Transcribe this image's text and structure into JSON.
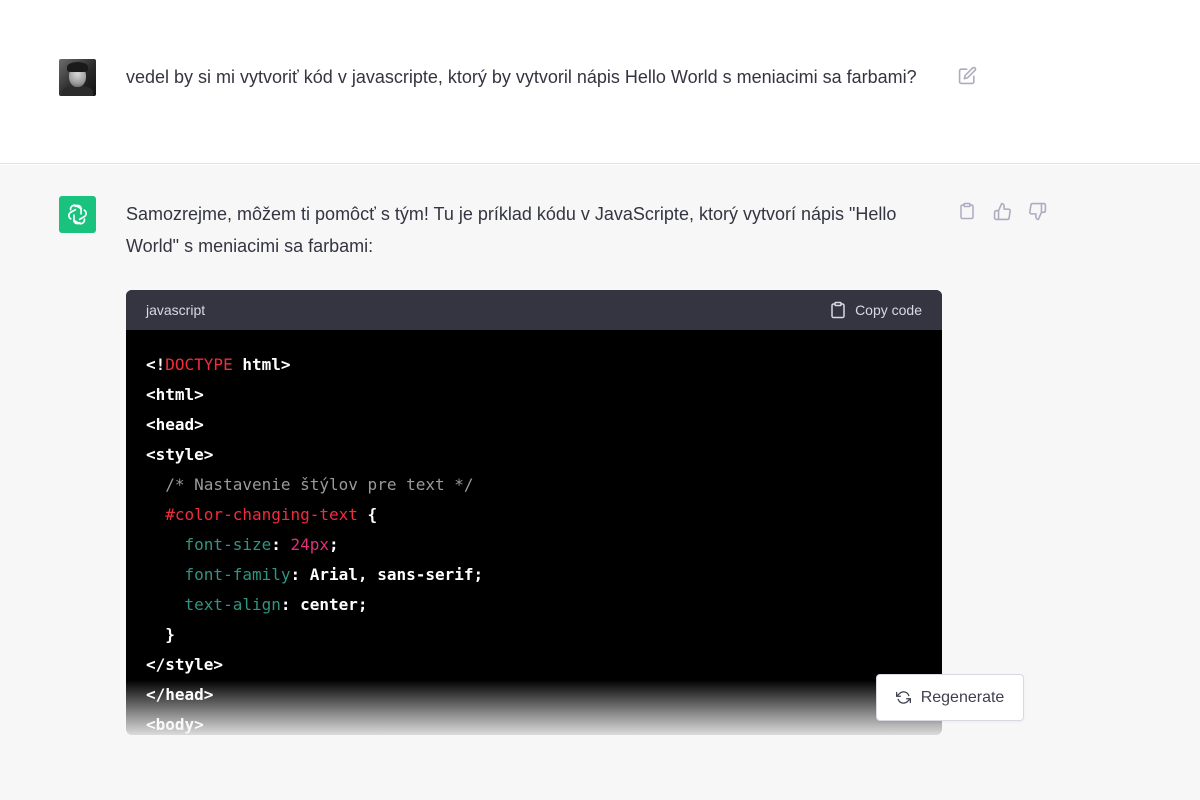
{
  "colors": {
    "accent": "#19c37d",
    "assistant_bg": "#f7f7f8",
    "code_bg": "#000000",
    "code_header_bg": "#343541"
  },
  "user_message": {
    "avatar": "user-photo",
    "text": "vedel by si mi vytvoriť kód v javascripte, ktorý by vytvoril nápis Hello World s meniacimi sa farbami?",
    "edit_icon": "edit-icon"
  },
  "assistant_message": {
    "avatar": "openai-logo-icon",
    "text": "Samozrejme, môžem ti pomôcť s tým! Tu je príklad kódu v JavaScripte, ktorý vytvorí nápis \"Hello World\" s meniacimi sa farbami:",
    "actions": [
      "clipboard-icon",
      "thumbs-up-icon",
      "thumbs-down-icon"
    ],
    "code_block": {
      "language": "javascript",
      "copy_label": "Copy code",
      "lines": [
        [
          {
            "t": "<!",
            "c": "tag"
          },
          {
            "t": "DOCTYPE",
            "c": "doctype"
          },
          {
            "t": " html>",
            "c": "tag"
          }
        ],
        [
          {
            "t": "<html>",
            "c": "tag"
          }
        ],
        [
          {
            "t": "<head>",
            "c": "tag"
          }
        ],
        [
          {
            "t": "<style>",
            "c": "tag"
          }
        ],
        [
          {
            "t": "  /* Nastavenie štýlov pre text */",
            "c": "comment"
          }
        ],
        [
          {
            "t": "  #color-changing-text",
            "c": "selector"
          },
          {
            "t": " {",
            "c": "tag"
          }
        ],
        [
          {
            "t": "    font-size",
            "c": "prop"
          },
          {
            "t": ": ",
            "c": "tag"
          },
          {
            "t": "24px",
            "c": "num"
          },
          {
            "t": ";",
            "c": "tag"
          }
        ],
        [
          {
            "t": "    font-family",
            "c": "prop"
          },
          {
            "t": ": Arial, sans-serif;",
            "c": "val"
          }
        ],
        [
          {
            "t": "    text-align",
            "c": "prop"
          },
          {
            "t": ": center;",
            "c": "val"
          }
        ],
        [
          {
            "t": "  }",
            "c": "tag"
          }
        ],
        [
          {
            "t": "</style>",
            "c": "tag"
          }
        ],
        [
          {
            "t": "</head>",
            "c": "tag"
          }
        ],
        [
          {
            "t": "<body>",
            "c": "tag"
          }
        ]
      ]
    }
  },
  "regenerate": {
    "label": "Regenerate",
    "icon": "refresh-icon"
  }
}
